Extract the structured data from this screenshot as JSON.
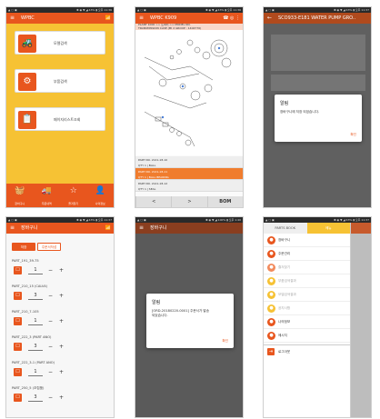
{
  "phone1": {
    "status_left": "▲ ▢ ▣",
    "status_right": "✱ ◉ ▼ ◢ 43% ▮ 오후 11:36",
    "title": "WPBC",
    "wifi_icon": "📶",
    "cards": [
      {
        "label": "모델검색",
        "icon": "🚜"
      },
      {
        "label": "부품검색",
        "icon": "⚙"
      },
      {
        "label": "페이지리스트조회",
        "icon": "📋"
      }
    ],
    "nav": [
      {
        "label": "장바구니",
        "icon": "🧺"
      },
      {
        "label": "주문내역",
        "icon": "🚚"
      },
      {
        "label": "즐겨찾기",
        "icon": "☆"
      },
      {
        "label": "나의정보",
        "icon": "👤"
      }
    ]
  },
  "phone2": {
    "status_left": "▲ ▢ ▣",
    "status_right": "✱ ◉ ▼ ◢ 43% ▮ 오후 11:36",
    "title": "WPBC K909",
    "crumb_line1": "PLANT 1000 >> 트랙터 >> MODEL NO.",
    "crumb_line2": "TRANSMISSION CASE (MI 2 GROUP : 1404770)",
    "parts": [
      "PART NO. 2141-18-10",
      "QTY 1  |  BALL",
      "PART NO. 2141-18-11",
      "QTY 1  |  BALL BEARING",
      "PART NO. 2141-18-12",
      "QTY 1  |  SEAL"
    ],
    "prev_label": "<",
    "next_label": ">",
    "bom_label": "BOM"
  },
  "phone3": {
    "status_left": "▲ ▢ ▣",
    "status_right": "✱ ◉ ▼ ◢ 43% ▮ 오후 11:37",
    "title": "SCO933-E181  WATER PUMP GRO..",
    "dialog_title": "알림",
    "dialog_message": "장바구니에 저장 되었습니다.",
    "dialog_ok": "확인"
  },
  "phone4": {
    "status_left": "▲ ▢ ▣",
    "status_right": "✱ ◉ ▼ ◢ 43% ▮ 오후 11:37",
    "title": "장바구니",
    "tab_on": "저장",
    "tab_off": "주문서작성",
    "items": [
      {
        "name": "PART_191_39-75",
        "qty": "1",
        "box": "☐"
      },
      {
        "name": "PART_210_15 (CALV4)",
        "qty": "3",
        "box": "☐"
      },
      {
        "name": "PART_210_7-105",
        "qty": "1",
        "box": "☐"
      },
      {
        "name": "PART_222_3 (PART ANO)",
        "qty": "3",
        "box": "☐"
      },
      {
        "name": "PART_222_3-1 (PART ANO)",
        "qty": "1",
        "box": "☐"
      },
      {
        "name": "PART_250_5 (조립품)",
        "qty": "3",
        "box": "☐"
      }
    ],
    "minus": "−",
    "plus": "+"
  },
  "phone5": {
    "status_left": "▲ ▢ ▣",
    "status_right": "✱ ◉ ▼ ◢ 100% ▮ 오후 1:40",
    "title": "장바구니",
    "dialog_title": "알림",
    "dialog_message": "[ORD-20180220-0001] 주문서가 발송\n되었습니다.",
    "dialog_ok": "확인"
  },
  "phone6": {
    "status_left": "▲ ▢ ▣",
    "status_right": "✱ ◉ ▼ ◢ 43% ▮ 오후 11:37",
    "tab_a": "PARTS BOOK",
    "tab_b": "메뉴",
    "menu": [
      {
        "label": "장바구니",
        "icon": "●",
        "color": "#e8561e",
        "faded": false
      },
      {
        "label": "주문관리",
        "icon": "●",
        "color": "#e8561e",
        "faded": false
      },
      {
        "label": "즐겨찾기",
        "icon": "●",
        "color": "#f28a5c",
        "faded": true
      },
      {
        "label": "부품검색결과",
        "icon": "●",
        "color": "#f6c234",
        "faded": true
      },
      {
        "label": "모델검색결과",
        "icon": "●",
        "color": "#f6c234",
        "faded": true
      },
      {
        "label": "공지사항",
        "icon": "●",
        "color": "#f6c234",
        "faded": true
      },
      {
        "label": "나의정보",
        "icon": "●",
        "color": "#e8561e",
        "faded": false
      },
      {
        "label": "메시지",
        "icon": "●",
        "color": "#e8561e",
        "faded": false
      }
    ],
    "logout": "로그아웃",
    "logout_icon": "⇥"
  }
}
